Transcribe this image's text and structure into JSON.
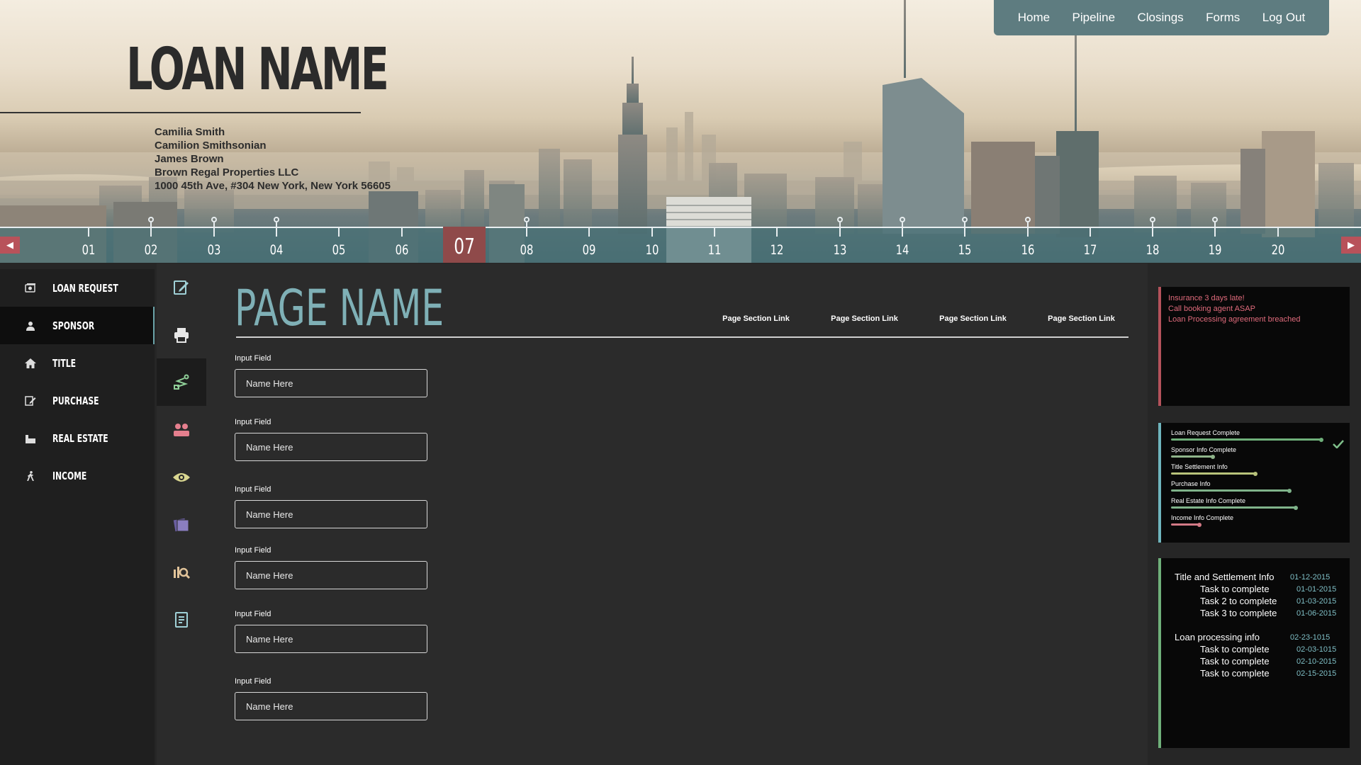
{
  "hero": {
    "loan_name": "LOAN NAME",
    "contact": [
      "Camilia Smith",
      "Camilion Smithsonian",
      "James Brown",
      "Brown Regal Properties LLC",
      "1000 45th Ave, #304 New York, New York 56605"
    ]
  },
  "topnav": [
    "Home",
    "Pipeline",
    "Closings",
    "Forms",
    "Log Out"
  ],
  "timeline": {
    "steps": [
      "01",
      "02",
      "03",
      "04",
      "05",
      "06",
      "07",
      "08",
      "09",
      "10",
      "11",
      "12",
      "13",
      "14",
      "15",
      "16",
      "17",
      "18",
      "19",
      "20"
    ],
    "active": "07",
    "left_arrow": "◀",
    "right_arrow": "▶"
  },
  "sidebar": {
    "items": [
      {
        "label": "LOAN REQUEST",
        "icon": "money-icon"
      },
      {
        "label": "SPONSOR",
        "icon": "person-icon",
        "active": true
      },
      {
        "label": "TITLE",
        "icon": "home-icon"
      },
      {
        "label": "PURCHASE",
        "icon": "edit-document-icon"
      },
      {
        "label": "REAL ESTATE",
        "icon": "building-icon"
      },
      {
        "label": "INCOME",
        "icon": "walking-person-icon"
      }
    ]
  },
  "rail": {
    "icons": [
      "edit-icon",
      "printer-icon",
      "route-icon",
      "users-icon",
      "eye-icon",
      "cards-icon",
      "search-chart-icon",
      "document-icon"
    ]
  },
  "main": {
    "page_name": "PAGE NAME",
    "section_links": [
      "Page Section Link",
      "Page Section Link",
      "Page Section Link",
      "Page Section Link"
    ],
    "fields": [
      {
        "label": "Input Field",
        "placeholder": "Name Here"
      },
      {
        "label": "Input Field",
        "placeholder": "Name Here"
      },
      {
        "label": "Input Field",
        "placeholder": "Name Here"
      },
      {
        "label": "Input Field",
        "placeholder": "Name Here"
      },
      {
        "label": "Input Field",
        "placeholder": "Name Here"
      },
      {
        "label": "Input Field",
        "placeholder": "Name Here"
      }
    ]
  },
  "alerts": [
    "Insurance 3 days late!",
    "Call booking agent ASAP",
    "Loan Processing agreement breached"
  ],
  "progress": [
    {
      "label": "Loan Request Complete",
      "value": 1.0,
      "color": "#6fb07a",
      "checked": true
    },
    {
      "label": "Sponsor Info Complete",
      "value": 0.28,
      "color": "#8fb48a"
    },
    {
      "label": "Title Settlement Info",
      "value": 0.56,
      "color": "#b8c27a"
    },
    {
      "label": "Purchase Info",
      "value": 0.79,
      "color": "#7fb38a"
    },
    {
      "label": "Real Estate Info Complete",
      "value": 0.83,
      "color": "#7fb38a"
    },
    {
      "label": "Income Info Complete",
      "value": 0.19,
      "color": "#d37a86"
    }
  ],
  "tasks": [
    {
      "title": "Title and Settlement Info",
      "date": "01-12-2015",
      "items": [
        {
          "name": "Task to complete",
          "date": "01-01-2015"
        },
        {
          "name": "Task 2 to complete",
          "date": "01-03-2015"
        },
        {
          "name": "Task 3 to complete",
          "date": "01-06-2015"
        }
      ]
    },
    {
      "title": "Loan processing info",
      "date": "02-23-1015",
      "items": [
        {
          "name": "Task to complete",
          "date": "02-03-1015"
        },
        {
          "name": "Task to complete",
          "date": "02-10-2015"
        },
        {
          "name": "Task to complete",
          "date": "02-15-2015"
        }
      ]
    }
  ]
}
